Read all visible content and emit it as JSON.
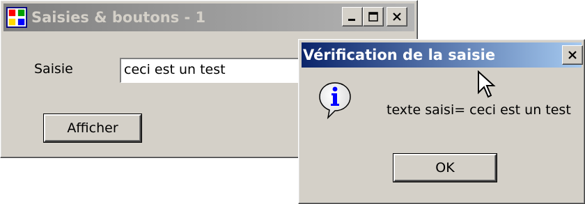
{
  "main_window": {
    "title": "Saisies & boutons - 1",
    "icon": "app-window-icon",
    "controls": {
      "minimize": "minimize-icon",
      "maximize": "maximize-icon",
      "close": "close-icon"
    },
    "input_label": "Saisie",
    "input_value": "ceci est un test",
    "button_label": "Afficher"
  },
  "dialog": {
    "title": "Vérification de la saisie",
    "icon": "info-icon",
    "message": "texte saisi= ceci est un test",
    "ok_label": "OK",
    "close_icon": "close-icon"
  }
}
